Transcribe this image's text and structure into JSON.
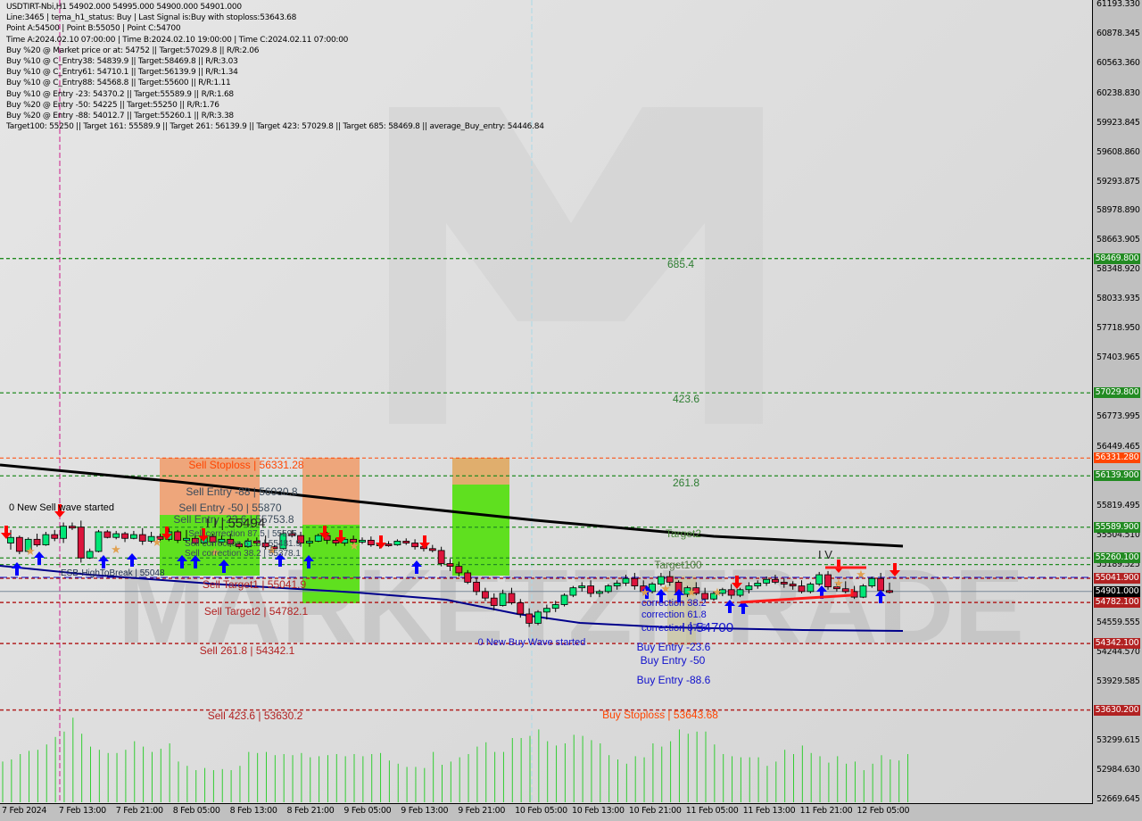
{
  "window": {
    "symbol": "USDTIRT-Nbi",
    "timeframe": "H1",
    "ohlc": "54902.000 54995.000 54900.000 54901.000"
  },
  "info_lines": [
    "USDTIRT-Nbi,H1  54902.000 54995.000 54900.000 54901.000",
    "Line:3465 | tema_h1_status: Buy | Last Signal is:Buy with stoploss:53643.68",
    "Point A:54500 | Point B:55050 | Point C:54700",
    "Time A:2024.02.10 07:00:00 | Time B:2024.02.10 19:00:00 | Time C:2024.02.11 07:00:00",
    "Buy %20 @ Market price or at: 54752 || Target:57029.8 || R/R:2.06",
    "Buy %10 @ C_Entry38: 54839.9 || Target:58469.8 || R/R:3.03",
    "Buy %10 @ C_Entry61: 54710.1 || Target:56139.9 || R/R:1.34",
    "Buy %10 @ C_Entry88: 54568.8 || Target:55600 || R/R:1.11",
    "Buy %10 @ Entry -23: 54370.2 || Target:55589.9 || R/R:1.68",
    "Buy %20 @ Entry -50: 54225 || Target:55250 || R/R:1.76",
    "Buy %20 @ Entry -88: 54012.7 || Target:55260.1 || R/R:3.38",
    "Target100: 55250 || Target 161: 55589.9 || Target 261: 56139.9 || Target 423: 57029.8 || Target 685: 58469.8 || average_Buy_entry: 54446.84"
  ],
  "colors": {
    "bull": "#00e676",
    "bear": "#dc143c",
    "target_green": "#228b22",
    "stop_orange": "#ff4500",
    "sell_red": "#b22222",
    "ema_black": "#000000",
    "ema_navy": "#00008b",
    "buy_arrow": "#0000ff",
    "sell_arrow": "#ff0000",
    "volume": "#32cd32"
  },
  "chart_data": {
    "type": "candlestick",
    "title": "USDTIRT-Nbi,H1",
    "ylim": [
      52669.645,
      61193.33
    ],
    "y_ticks": [
      "61193.330",
      "60878.345",
      "60563.360",
      "60238.830",
      "59923.845",
      "59608.860",
      "59293.875",
      "58978.890",
      "58663.905",
      "58348.920",
      "58033.935",
      "57718.950",
      "57403.965",
      "56773.995",
      "56449.465",
      "55819.495",
      "55504.510",
      "55189.525",
      "54559.555",
      "54244.570",
      "53929.585",
      "53299.615",
      "52984.630",
      "52669.645"
    ],
    "y_tick_values": [
      61193.33,
      60878.345,
      60563.36,
      60238.83,
      59923.845,
      59608.86,
      59293.875,
      58978.89,
      58663.905,
      58348.92,
      58033.935,
      57718.95,
      57403.965,
      56773.995,
      56449.465,
      55819.495,
      55504.51,
      55189.525,
      54559.555,
      54244.57,
      53929.585,
      53299.615,
      52984.63,
      52669.645
    ],
    "x_ticks": [
      "7 Feb 2024",
      "7 Feb 13:00",
      "7 Feb 21:00",
      "8 Feb 05:00",
      "8 Feb 13:00",
      "8 Feb 21:00",
      "9 Feb 05:00",
      "9 Feb 13:00",
      "9 Feb 21:00",
      "10 Feb 05:00",
      "10 Feb 13:00",
      "10 Feb 21:00",
      "11 Feb 05:00",
      "11 Feb 13:00",
      "11 Feb 21:00",
      "12 Feb 05:00"
    ],
    "price_tags": [
      {
        "value": 58469.8,
        "label": "58469.800",
        "color": "#228b22"
      },
      {
        "value": 57029.8,
        "label": "57029.800",
        "color": "#228b22"
      },
      {
        "value": 56331.28,
        "label": "56331.280",
        "color": "#ff4500"
      },
      {
        "value": 56139.9,
        "label": "56139.900",
        "color": "#228b22"
      },
      {
        "value": 55589.9,
        "label": "55589.900",
        "color": "#228b22"
      },
      {
        "value": 55260.1,
        "label": "55260.100",
        "color": "#228b22"
      },
      {
        "value": 55041.9,
        "label": "55041.900",
        "color": "#b22222"
      },
      {
        "value": 54901.0,
        "label": "54901.000",
        "color": "#000000"
      },
      {
        "value": 54782.1,
        "label": "54782.100",
        "color": "#b22222"
      },
      {
        "value": 54342.1,
        "label": "54342.100",
        "color": "#b22222"
      },
      {
        "value": 53630.2,
        "label": "53630.200",
        "color": "#b22222"
      }
    ],
    "levels": [
      {
        "value": 58469.8,
        "style": "green",
        "label": "685.4"
      },
      {
        "value": 57029.8,
        "style": "green",
        "label": "423.6"
      },
      {
        "value": 56331.28,
        "style": "orange",
        "label": "Sell Stoploss | 56331.28"
      },
      {
        "value": 56139.9,
        "style": "green",
        "label": "261.8"
      },
      {
        "value": 55589.9,
        "style": "green",
        "label": "Target2"
      },
      {
        "value": 55260.1,
        "style": "green",
        "label": "Target100"
      },
      {
        "value": 55041.9,
        "style": "red",
        "label": "Sell Target1 | 55041.9"
      },
      {
        "value": 54782.1,
        "style": "red",
        "label": "Sell Target2 | 54782.1"
      },
      {
        "value": 54342.1,
        "style": "red",
        "label": "Sell 261.8 | 54342.1"
      },
      {
        "value": 53630.2,
        "style": "red",
        "label": "Sell 423.6 | 53630.2"
      },
      {
        "value": 53643.68,
        "style": "orange-buy",
        "label": "Buy Stoploss | 53643.68"
      }
    ],
    "annotations": {
      "sell_entry_88": "Sell Entry -88 | 56030.8",
      "sell_entry_50": "Sell Entry -50 | 55870",
      "sell_entry_23": "Sell Entry -23.6 | 55753.8",
      "sell_point": "I I | 55494",
      "sell_corr_875": "Sell correction 87.5 | 55595",
      "sell_corr_618": "Sell correction 61.8 | 55481.9",
      "sell_corr_382": "Sell correction 38.2 | 55378.1",
      "new_sell_wave": "0 New Sell wave started",
      "esb": "ESB-HighToBreak | 55048",
      "new_buy_wave": "0 New Buy Wave started",
      "buy_corr_382": "correction 38.2",
      "buy_corr_618": "correction 61.8",
      "buy_corr_875": "correction 87.5",
      "buy_point": "I | 54700",
      "buy_entry_23": "Buy Entry -23.6",
      "buy_entry_50": "Buy Entry -50",
      "buy_entry_88": "Buy Entry -88.6",
      "wave_iv": "I V",
      "watermark": "MARKETZITRADE"
    },
    "candles": [
      [
        55420,
        55560,
        55350,
        55480
      ],
      [
        55480,
        55500,
        55300,
        55330
      ],
      [
        55330,
        55480,
        55320,
        55460
      ],
      [
        55460,
        55520,
        55380,
        55400
      ],
      [
        55400,
        55540,
        55390,
        55510
      ],
      [
        55510,
        55560,
        55440,
        55470
      ],
      [
        55470,
        55640,
        55420,
        55600
      ],
      [
        55600,
        55640,
        55560,
        55590
      ],
      [
        55590,
        55660,
        55210,
        55260
      ],
      [
        55260,
        55360,
        55250,
        55330
      ],
      [
        55330,
        55560,
        55320,
        55540
      ],
      [
        55540,
        55560,
        55470,
        55480
      ],
      [
        55480,
        55550,
        55460,
        55520
      ],
      [
        55520,
        55540,
        55430,
        55470
      ],
      [
        55470,
        55550,
        55460,
        55510
      ],
      [
        55510,
        55580,
        55400,
        55440
      ],
      [
        55440,
        55540,
        55420,
        55490
      ],
      [
        55490,
        55520,
        55430,
        55460
      ],
      [
        55460,
        55580,
        55440,
        55540
      ],
      [
        55540,
        55560,
        55420,
        55450
      ],
      [
        55450,
        55560,
        55430,
        55470
      ],
      [
        55470,
        55500,
        55400,
        55420
      ],
      [
        55420,
        55530,
        55410,
        55490
      ],
      [
        55490,
        55520,
        55390,
        55430
      ],
      [
        55430,
        55500,
        55400,
        55460
      ],
      [
        55460,
        55520,
        55380,
        55410
      ],
      [
        55410,
        55430,
        55360,
        55380
      ],
      [
        55380,
        55470,
        55370,
        55440
      ],
      [
        55440,
        55480,
        55390,
        55420
      ],
      [
        55420,
        55500,
        55350,
        55380
      ],
      [
        55380,
        55400,
        55340,
        55360
      ],
      [
        55360,
        55560,
        55350,
        55520
      ],
      [
        55520,
        55560,
        55480,
        55500
      ],
      [
        55500,
        55540,
        55380,
        55420
      ],
      [
        55420,
        55480,
        55380,
        55440
      ],
      [
        55440,
        55520,
        55430,
        55500
      ],
      [
        55500,
        55540,
        55410,
        55450
      ],
      [
        55450,
        55470,
        55390,
        55420
      ],
      [
        55420,
        55480,
        55390,
        55460
      ],
      [
        55460,
        55500,
        55400,
        55430
      ],
      [
        55430,
        55480,
        55410,
        55450
      ],
      [
        55450,
        55490,
        55380,
        55400
      ],
      [
        55400,
        55440,
        55360,
        55410
      ],
      [
        55410,
        55440,
        55380,
        55400
      ],
      [
        55400,
        55460,
        55390,
        55440
      ],
      [
        55440,
        55470,
        55400,
        55420
      ],
      [
        55420,
        55460,
        55350,
        55380
      ],
      [
        55380,
        55420,
        55330,
        55360
      ],
      [
        55360,
        55400,
        55320,
        55340
      ],
      [
        55340,
        55380,
        55170,
        55200
      ],
      [
        55200,
        55250,
        55120,
        55170
      ],
      [
        55170,
        55220,
        55060,
        55100
      ],
      [
        55100,
        55130,
        54980,
        55000
      ],
      [
        55000,
        55050,
        54860,
        54900
      ],
      [
        54900,
        54940,
        54800,
        54830
      ],
      [
        54830,
        54880,
        54700,
        54750
      ],
      [
        54750,
        54920,
        54740,
        54880
      ],
      [
        54880,
        54940,
        54760,
        54780
      ],
      [
        54780,
        54820,
        54620,
        54660
      ],
      [
        54660,
        54720,
        54520,
        54560
      ],
      [
        54560,
        54700,
        54540,
        54680
      ],
      [
        54680,
        54760,
        54600,
        54720
      ],
      [
        54720,
        54800,
        54680,
        54760
      ],
      [
        54760,
        54880,
        54740,
        54860
      ],
      [
        54860,
        54960,
        54840,
        54940
      ],
      [
        54940,
        55000,
        54900,
        54960
      ],
      [
        54960,
        55020,
        54840,
        54880
      ],
      [
        54880,
        54920,
        54840,
        54900
      ],
      [
        54900,
        54980,
        54880,
        54960
      ],
      [
        54960,
        55020,
        54920,
        54990
      ],
      [
        54990,
        55080,
        54960,
        55040
      ],
      [
        55040,
        55100,
        54920,
        54960
      ],
      [
        54960,
        55020,
        54860,
        54900
      ],
      [
        54900,
        55000,
        54880,
        54980
      ],
      [
        54980,
        55100,
        54960,
        55060
      ],
      [
        55060,
        55120,
        54960,
        55000
      ],
      [
        55000,
        55020,
        54840,
        54870
      ],
      [
        54870,
        54960,
        54840,
        54940
      ],
      [
        54940,
        55000,
        54860,
        54880
      ],
      [
        54880,
        54940,
        54780,
        54820
      ],
      [
        54820,
        54900,
        54800,
        54880
      ],
      [
        54880,
        54940,
        54850,
        54920
      ],
      [
        54920,
        54980,
        54820,
        54860
      ],
      [
        54860,
        54940,
        54840,
        54920
      ],
      [
        54920,
        55000,
        54880,
        54960
      ],
      [
        54960,
        55020,
        54930,
        54990
      ],
      [
        54990,
        55060,
        54960,
        55030
      ],
      [
        55030,
        55080,
        54980,
        55000
      ],
      [
        55000,
        55040,
        54940,
        54980
      ],
      [
        54980,
        55010,
        54920,
        54960
      ],
      [
        54960,
        55020,
        54880,
        54900
      ],
      [
        54900,
        55000,
        54880,
        54980
      ],
      [
        54980,
        55110,
        54960,
        55080
      ],
      [
        55080,
        55120,
        54920,
        54950
      ],
      [
        54950,
        55000,
        54900,
        54930
      ],
      [
        54930,
        55010,
        54880,
        54900
      ],
      [
        54900,
        54960,
        54820,
        54840
      ],
      [
        54840,
        54980,
        54830,
        54960
      ],
      [
        54960,
        55060,
        54940,
        55040
      ],
      [
        55040,
        55100,
        54880,
        54910
      ],
      [
        54910,
        54995,
        54880,
        54901
      ]
    ],
    "volume": [
      38,
      40,
      45,
      48,
      49,
      54,
      61,
      66,
      79,
      64,
      52,
      49,
      46,
      46,
      49,
      57,
      52,
      47,
      50,
      55,
      38,
      34,
      30,
      32,
      30,
      31,
      30,
      34,
      47,
      46,
      47,
      44,
      45,
      44,
      46,
      42,
      43,
      44,
      45,
      43,
      45,
      43,
      45,
      46,
      39,
      36,
      33,
      33,
      32,
      47,
      35,
      38,
      42,
      45,
      52,
      56,
      47,
      47,
      60,
      60,
      62,
      68,
      57,
      53,
      55,
      63,
      62,
      58,
      55,
      44,
      40,
      36,
      43,
      42,
      55,
      52,
      57,
      68,
      64,
      66,
      66,
      54,
      45,
      43,
      42,
      42,
      42,
      34,
      38,
      49,
      45,
      53,
      46,
      43,
      37,
      43,
      36,
      38,
      30,
      36,
      44,
      40,
      39,
      45
    ]
  }
}
